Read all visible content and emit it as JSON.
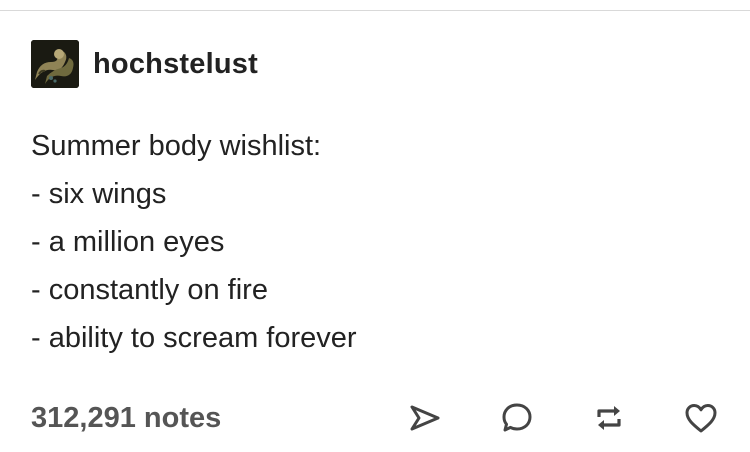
{
  "post": {
    "username": "hochstelust",
    "avatar_icon": "avatar-image",
    "body_lines": [
      "Summer body wishlist:",
      "- six wings",
      "- a million eyes",
      "- constantly on fire",
      "- ability to scream forever"
    ],
    "notes_label": "312,291 notes"
  },
  "actions": [
    {
      "name": "share-button",
      "icon": "share-icon"
    },
    {
      "name": "reply-button",
      "icon": "comment-icon"
    },
    {
      "name": "reblog-button",
      "icon": "reblog-icon"
    },
    {
      "name": "like-button",
      "icon": "heart-icon"
    }
  ],
  "colors": {
    "text": "#222222",
    "notes": "#555555",
    "icon": "#444444",
    "divider": "#d9d9d9"
  }
}
